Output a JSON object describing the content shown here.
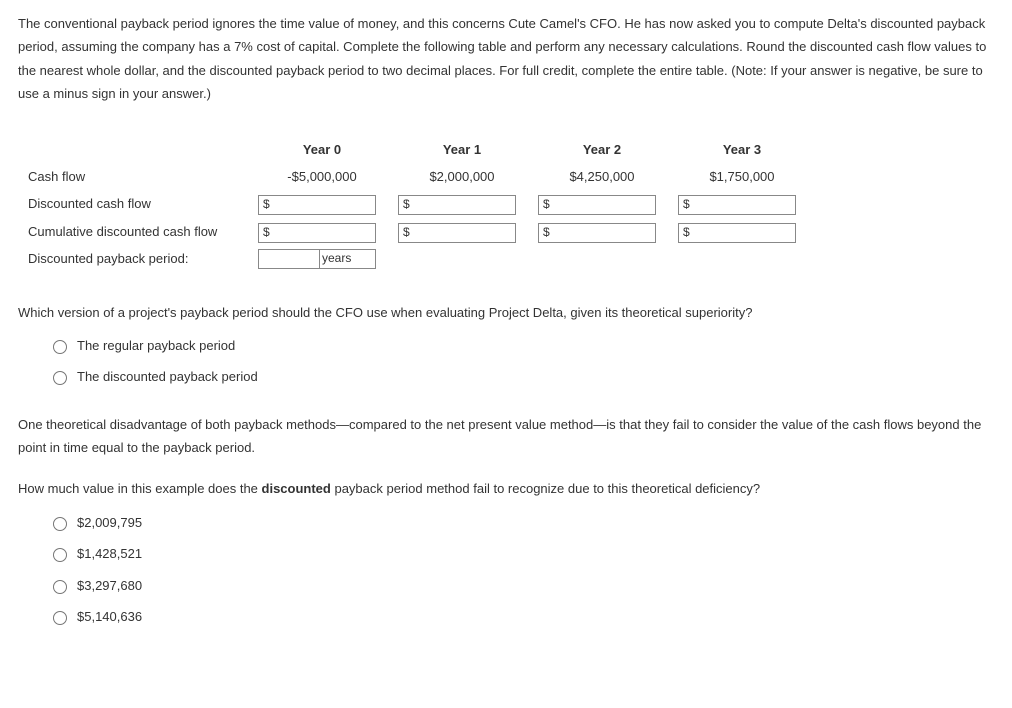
{
  "intro": "The conventional payback period ignores the time value of money, and this concerns Cute Camel's CFO. He has now asked you to compute Delta's discounted payback period, assuming the company has a 7% cost of capital. Complete the following table and perform any necessary calculations. Round the discounted cash flow values to the nearest whole dollar, and the discounted payback period to two decimal places. For full credit, complete the entire table. (Note: If your answer is negative, be sure to use a minus sign in your answer.)",
  "table": {
    "headers": [
      "Year 0",
      "Year 1",
      "Year 2",
      "Year 3"
    ],
    "rows": {
      "cashflow": {
        "label": "Cash flow",
        "values": [
          "-$5,000,000",
          "$2,000,000",
          "$4,250,000",
          "$1,750,000"
        ]
      },
      "dcf": {
        "label": "Discounted cash flow"
      },
      "cumdcf": {
        "label": "Cumulative discounted cash flow"
      },
      "dpp": {
        "label": "Discounted payback period:",
        "suffix": "years"
      }
    },
    "input_prefix": "$"
  },
  "q1": {
    "text": "Which version of a project's payback period should the CFO use when evaluating Project Delta, given its theoretical superiority?",
    "options": [
      "The regular payback period",
      "The discounted payback period"
    ]
  },
  "para2_a": "One theoretical disadvantage of both payback methods—compared to the net present value method—is that they fail to consider the value of the cash flows beyond the point in time equal to the payback period.",
  "q2": {
    "prefix": "How much value in this example does the ",
    "bold": "discounted",
    "suffix": " payback period method fail to recognize due to this theoretical deficiency?",
    "options": [
      "$2,009,795",
      "$1,428,521",
      "$3,297,680",
      "$5,140,636"
    ]
  }
}
